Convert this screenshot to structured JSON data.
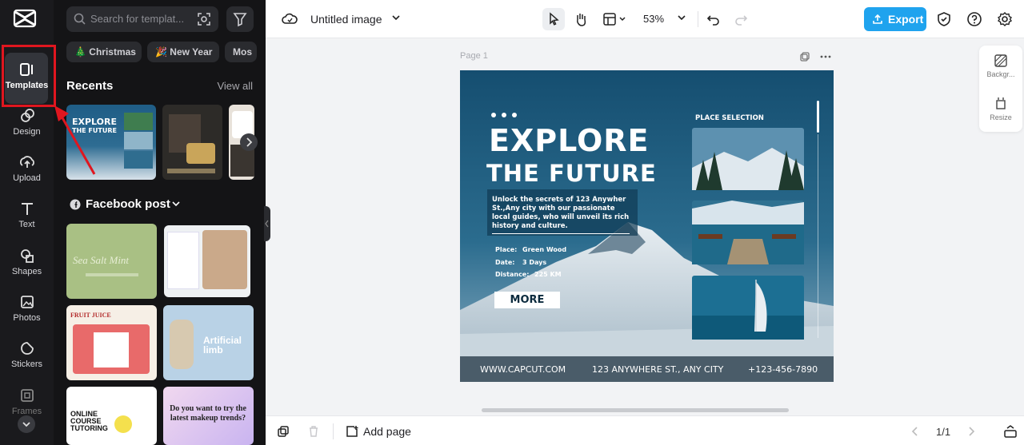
{
  "rail": {
    "items": [
      {
        "label": "Templates",
        "icon": "templates-icon"
      },
      {
        "label": "Design",
        "icon": "design-icon"
      },
      {
        "label": "Upload",
        "icon": "upload-icon"
      },
      {
        "label": "Text",
        "icon": "text-icon"
      },
      {
        "label": "Shapes",
        "icon": "shapes-icon"
      },
      {
        "label": "Photos",
        "icon": "photos-icon"
      },
      {
        "label": "Stickers",
        "icon": "stickers-icon"
      },
      {
        "label": "Frames",
        "icon": "frames-icon"
      }
    ],
    "highlight_color": "#e0161f"
  },
  "panel": {
    "search_placeholder": "Search for templat...",
    "chips": [
      "🎄 Christmas",
      "🎉 New Year",
      "Mos"
    ],
    "recents_title": "Recents",
    "view_all": "View all",
    "facebook_title": "Facebook post",
    "thumb_texts": {
      "explore": "EXPLORE",
      "the_future": "THE FUTURE",
      "sea_salt": "Sea Salt Mint",
      "fruit_juice": "FRUIT JUICE",
      "artificial": "Artificial limb",
      "online_course": "ONLINE COURSE TUTORING",
      "makeup": "Do you want to try the latest makeup trends?"
    }
  },
  "topbar": {
    "doc_title": "Untitled image",
    "zoom": "53%",
    "export_label": "Export",
    "accent": "#1fa3ee"
  },
  "canvas": {
    "page_label": "Page 1",
    "side_tools": [
      {
        "label": "Backgr...",
        "icon": "background-icon"
      },
      {
        "label": "Resize",
        "icon": "resize-icon"
      }
    ]
  },
  "design": {
    "title_line1": "EXPLORE",
    "title_line2": "THE FUTURE",
    "place_selection": "PLACE SELECTION",
    "description": "Unlock the secrets of 123 Anywher St.,Any city with our passionate local guides, who will unveil its rich history and culture.",
    "details": [
      {
        "label": "Place:",
        "value": "Green Wood"
      },
      {
        "label": "Date:",
        "value": "3 Days"
      },
      {
        "label": "Distance:",
        "value": "225 KM"
      }
    ],
    "more": "MORE",
    "footer_web": "WWW.CAPCUT.COM",
    "footer_addr": "123 ANYWHERE ST., ANY CITY",
    "footer_phone": "+123-456-7890"
  },
  "bottombar": {
    "add_page": "Add page",
    "pager": "1/1"
  }
}
